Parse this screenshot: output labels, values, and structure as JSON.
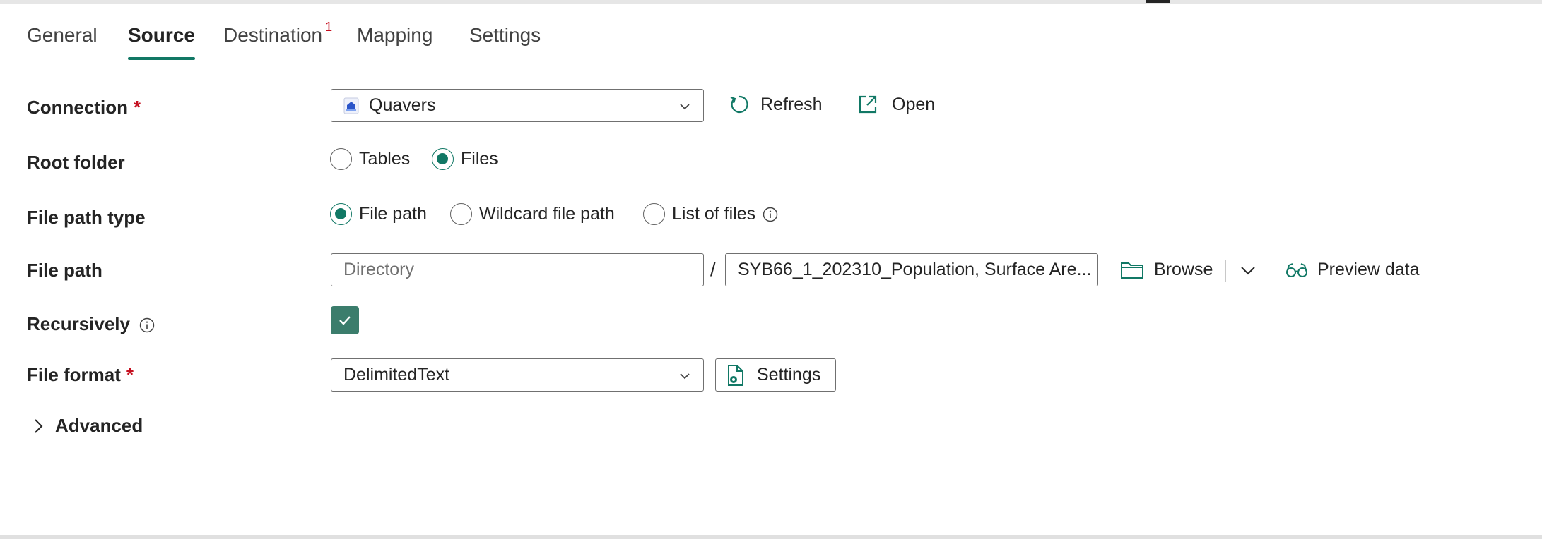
{
  "tabs": [
    {
      "label": "General"
    },
    {
      "label": "Source"
    },
    {
      "label": "Destination",
      "badge": "1"
    },
    {
      "label": "Mapping"
    },
    {
      "label": "Settings"
    }
  ],
  "active_tab": "Source",
  "accent_color": "#117865",
  "required_color": "#c50f1f",
  "connection": {
    "label": "Connection",
    "required_mark": "*",
    "value": "Quavers",
    "refresh_label": "Refresh",
    "open_label": "Open"
  },
  "root_folder": {
    "label": "Root folder",
    "options": [
      "Tables",
      "Files"
    ],
    "selected": "Files"
  },
  "file_path_type": {
    "label": "File path type",
    "options": [
      "File path",
      "Wildcard file path",
      "List of files"
    ],
    "selected": "File path"
  },
  "file_path": {
    "label": "File path",
    "directory_placeholder": "Directory",
    "separator": "/",
    "file_value": "SYB66_1_202310_Population, Surface Are...",
    "browse_label": "Browse",
    "preview_label": "Preview data"
  },
  "recursively": {
    "label": "Recursively",
    "checked": true
  },
  "file_format": {
    "label": "File format",
    "required_mark": "*",
    "value": "DelimitedText",
    "settings_label": "Settings"
  },
  "advanced": {
    "label": "Advanced"
  }
}
